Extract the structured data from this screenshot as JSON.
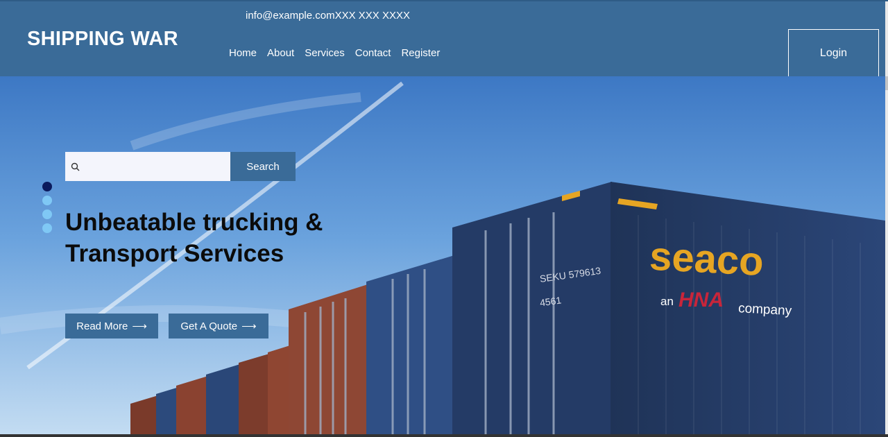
{
  "header": {
    "contact_line": "info@example.comXXX XXX XXXX",
    "logo": "SHIPPING WAR",
    "nav": [
      "Home",
      "About",
      "Services",
      "Contact",
      "Register"
    ],
    "login_label": "Login"
  },
  "hero": {
    "search": {
      "placeholder": "",
      "value": "",
      "button_label": "Search",
      "icon": "search-icon"
    },
    "slider_dots": {
      "count": 4,
      "active_index": 0
    },
    "headline": "Unbeatable trucking & Transport Services",
    "buttons": {
      "read_more": "Read More",
      "get_quote": "Get A Quote"
    },
    "arrow_glyph": "⟶",
    "container_texts": {
      "brand": "seaco",
      "tagline_prefix": "an",
      "tagline_brand": "HNA",
      "tagline_suffix": "company",
      "container_number": "SEKU 579613",
      "container_sub": "4561"
    }
  },
  "colors": {
    "header_bg": "#3a6b98",
    "button_bg": "#3a6b98",
    "dot_active": "#0b1a5c",
    "dot_inactive": "#7fc8f5",
    "container_blue": "#24395f",
    "brand_yellow": "#e6a523"
  }
}
